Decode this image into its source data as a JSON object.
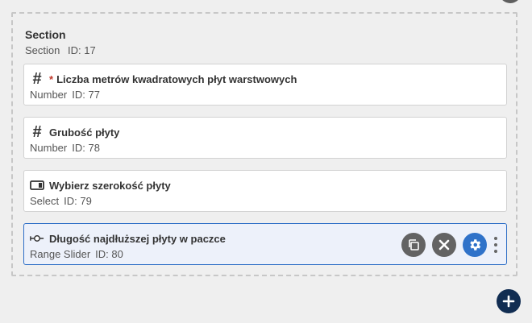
{
  "section": {
    "title": "Section",
    "type_label": "Section",
    "id_label": "ID: 17"
  },
  "fields": [
    {
      "icon": "hash-icon",
      "required_mark": "*",
      "title": "Liczba metrów kwadratowych płyt warstwowych",
      "type_label": "Number",
      "id_label": "ID: 77"
    },
    {
      "icon": "hash-icon",
      "title": "Grubość płyty",
      "type_label": "Number",
      "id_label": "ID: 78"
    },
    {
      "icon": "select-icon",
      "title": "Wybierz szerokość płyty",
      "type_label": "Select",
      "id_label": "ID: 79"
    },
    {
      "icon": "range-slider-icon",
      "title": "Długość najdłuższej płyty w paczce",
      "type_label": "Range Slider",
      "id_label": "ID: 80",
      "selected": true
    }
  ],
  "actions": [
    "copy-icon",
    "close-icon",
    "gear-icon",
    "kebab-menu-icon"
  ],
  "colors": {
    "background": "#efefef",
    "selected_border": "#2f6fc7",
    "selected_bg": "#edf1fa",
    "action_gray": "#636363",
    "action_blue": "#2f72c9",
    "add_button": "#112d52",
    "required": "#c0392b"
  }
}
